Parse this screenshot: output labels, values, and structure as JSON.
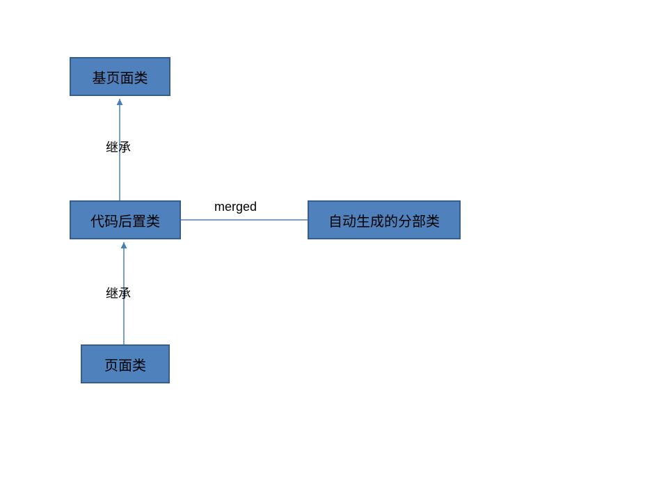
{
  "nodes": {
    "base_page": {
      "label": "基页面类"
    },
    "code_behind": {
      "label": "代码后置类"
    },
    "auto_partial": {
      "label": "自动生成的分部类"
    },
    "page": {
      "label": "页面类"
    }
  },
  "edges": {
    "inherit_top": {
      "label": "继承"
    },
    "inherit_bottom": {
      "label": "继承"
    },
    "merged": {
      "label": "merged"
    }
  },
  "colors": {
    "box_fill": "#4f81bd",
    "box_border": "#385d8a",
    "line": "#4a7ebb"
  }
}
